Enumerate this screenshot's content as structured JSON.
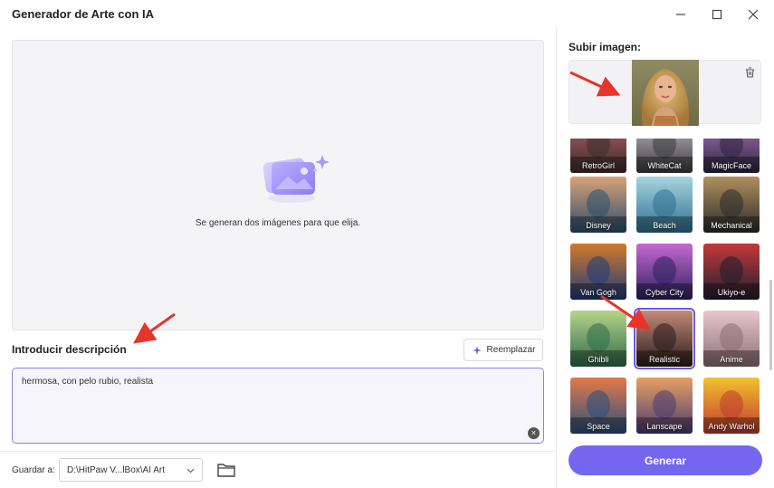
{
  "window": {
    "title": "Generador de Arte con IA"
  },
  "preview": {
    "text": "Se generan dos imágenes para que elija."
  },
  "description": {
    "title": "Introducir descripción",
    "replace_label": "Reemplazar",
    "value": "hermosa, con pelo rubio, realista"
  },
  "save": {
    "label": "Guardar a:",
    "path": "D:\\HitPaw V...lBox\\AI Art"
  },
  "upload": {
    "title": "Subir imagen:"
  },
  "styles": [
    {
      "label": "RetroGirl",
      "selected": false
    },
    {
      "label": "WhiteCat",
      "selected": false
    },
    {
      "label": "MagicFace",
      "selected": false
    },
    {
      "label": "Disney",
      "selected": false
    },
    {
      "label": "Beach",
      "selected": false
    },
    {
      "label": "Mechanical",
      "selected": false
    },
    {
      "label": "Van Gogh",
      "selected": false
    },
    {
      "label": "Cyber City",
      "selected": false
    },
    {
      "label": "Ukiyo-e",
      "selected": false
    },
    {
      "label": "Ghibli",
      "selected": false
    },
    {
      "label": "Realistic",
      "selected": true
    },
    {
      "label": "Anime",
      "selected": false
    },
    {
      "label": "Space",
      "selected": false
    },
    {
      "label": "Lanscape",
      "selected": false
    },
    {
      "label": "Andy Warhol",
      "selected": false
    }
  ],
  "generate_label": "Generar",
  "colors": {
    "accent": "#7566f0",
    "arrow": "#e8342a"
  }
}
